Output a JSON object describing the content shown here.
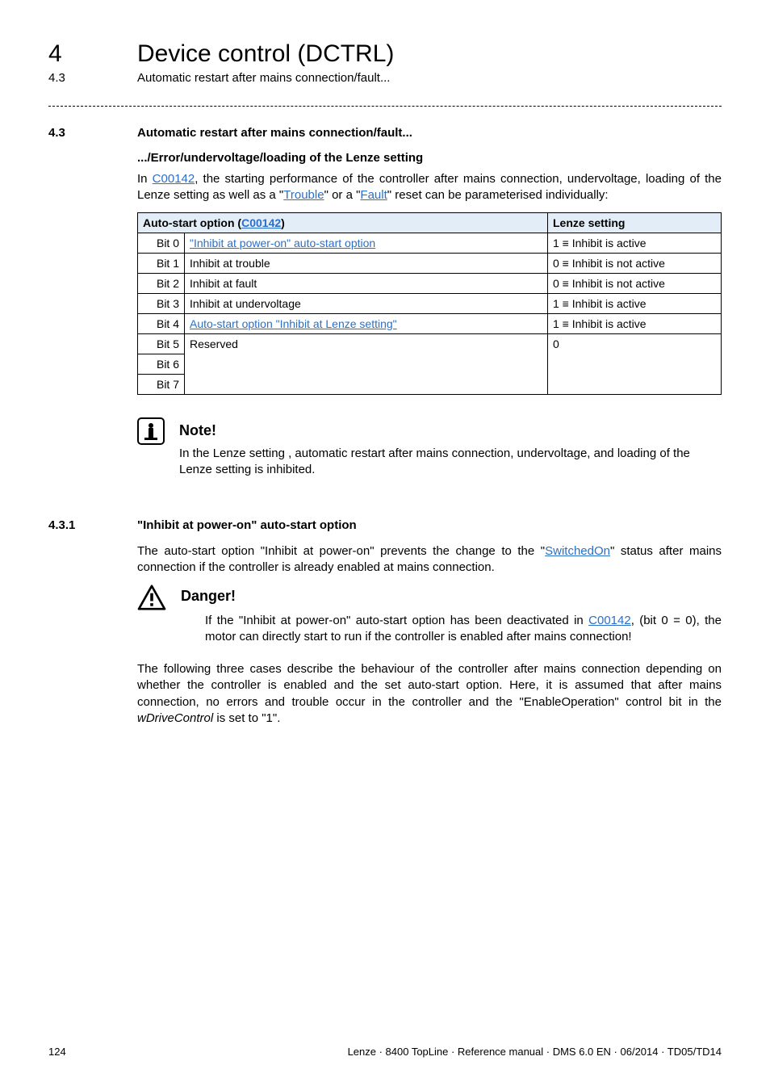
{
  "header": {
    "chapter_num": "4",
    "chapter_title": "Device control (DCTRL)",
    "subsection_num": "4.3",
    "subsection_title": "Automatic restart after mains connection/fault..."
  },
  "section43": {
    "num": "4.3",
    "title": "Automatic restart after mains connection/fault...",
    "subtitle": ".../Error/undervoltage/loading of the Lenze setting",
    "intro_pre": "In ",
    "intro_link": "C00142",
    "intro_mid1": ", the starting performance of the controller after mains connection, undervoltage, loading of the Lenze setting as well as a \"",
    "intro_link_trouble": "Trouble",
    "intro_mid2": "\" or a \"",
    "intro_link_fault": "Fault",
    "intro_post": "\" reset can be parameterised individually:"
  },
  "table": {
    "header_left_pre": "Auto-start option (",
    "header_left_link": "C00142",
    "header_left_post": ")",
    "header_right": "Lenze setting",
    "rows": [
      {
        "bit": "Bit 0",
        "desc": "\"Inhibit at power-on\" auto-start option",
        "link": true,
        "lenze": "1 ≡ Inhibit is active"
      },
      {
        "bit": "Bit 1",
        "desc": "Inhibit at trouble",
        "link": false,
        "lenze": "0 ≡ Inhibit is not active"
      },
      {
        "bit": "Bit 2",
        "desc": "Inhibit at fault",
        "link": false,
        "lenze": "0 ≡ Inhibit is not active"
      },
      {
        "bit": "Bit 3",
        "desc": "Inhibit at undervoltage",
        "link": false,
        "lenze": "1 ≡ Inhibit is active"
      },
      {
        "bit": "Bit 4",
        "desc": "Auto-start option \"Inhibit at Lenze setting\"",
        "link": true,
        "lenze": "1 ≡ Inhibit is active"
      },
      {
        "bit": "Bit 5",
        "desc": "Reserved",
        "link": false,
        "lenze": "0"
      },
      {
        "bit": "Bit 6",
        "desc": "",
        "link": false,
        "lenze": ""
      },
      {
        "bit": "Bit 7",
        "desc": "",
        "link": false,
        "lenze": ""
      }
    ]
  },
  "note": {
    "title": "Note!",
    "text": "In the Lenze setting , automatic restart after mains connection, undervoltage, and loading of the Lenze setting is inhibited."
  },
  "section431": {
    "num": "4.3.1",
    "title": "\"Inhibit at power-on\" auto-start option",
    "para_pre": "The auto-start option \"Inhibit at power-on\" prevents the change to the \"",
    "para_link": "SwitchedOn",
    "para_post": "\" status after mains connection if the controller is already enabled at mains connection."
  },
  "danger": {
    "title": "Danger!",
    "text_pre": "If the  \"Inhibit at power-on\" auto-start option has been deactivated in ",
    "text_link": "C00142",
    "text_post": ", (bit 0 = 0), the motor can directly start to run if the controller is enabled after mains connection!"
  },
  "closing": {
    "p1": "The following three cases describe the behaviour of the controller after mains connection depending on whether the controller is enabled and the set auto-start option. Here, it is assumed that after mains connection, no errors and trouble occur in the controller and the \"EnableOperation\" control bit in the ",
    "italic": "wDriveControl",
    "p2": " is set to \"1\"."
  },
  "footer": {
    "page": "124",
    "meta": "Lenze · 8400 TopLine · Reference manual · DMS 6.0 EN · 06/2014 · TD05/TD14"
  }
}
